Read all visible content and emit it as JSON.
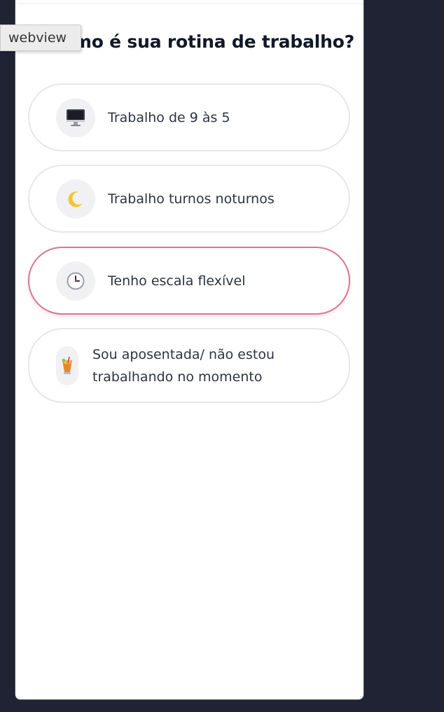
{
  "debug_overlay": {
    "label": "webview"
  },
  "question": {
    "title": "Como é sua rotina de trabalho?"
  },
  "options": [
    {
      "label": "Trabalho de 9 às 5",
      "icon": "desktop-computer-icon",
      "selected": false
    },
    {
      "label": "Trabalho turnos noturnos",
      "icon": "crescent-moon-icon",
      "selected": false
    },
    {
      "label": "Tenho escala flexível",
      "icon": "clock-icon",
      "selected": true
    },
    {
      "label": "Sou aposentada/ não estou trabalhando no momento",
      "icon": "tropical-drink-icon",
      "selected": false
    }
  ],
  "colors": {
    "background": "#1f2333",
    "selected_border": "#d57895",
    "option_border": "#e7e7e9",
    "text": "#2d3340"
  }
}
